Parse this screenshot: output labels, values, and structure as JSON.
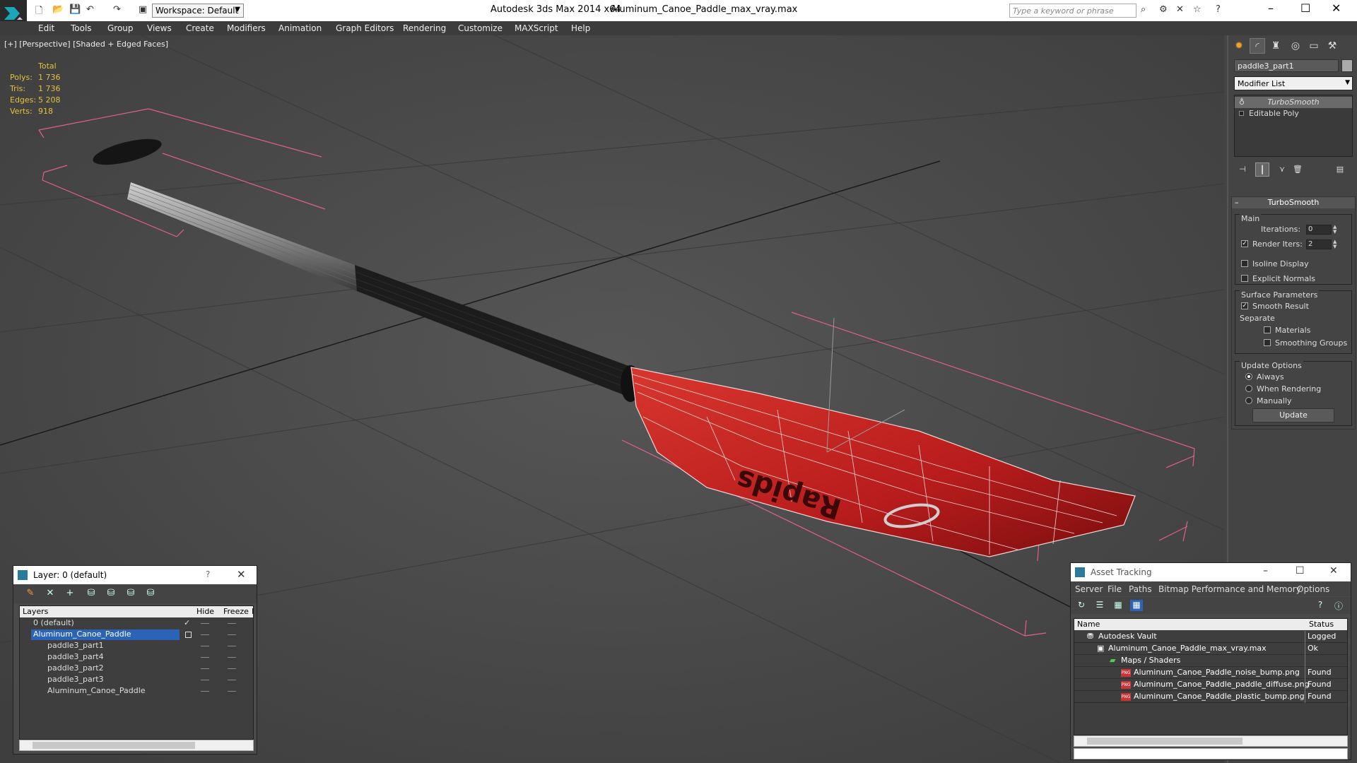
{
  "app": {
    "title": "Autodesk 3ds Max  2014 x64",
    "file": "Aluminum_Canoe_Paddle_max_vray.max",
    "workspace": "Workspace: Default",
    "search_placeholder": "Type a keyword or phrase"
  },
  "menu": [
    "Edit",
    "Tools",
    "Group",
    "Views",
    "Create",
    "Modifiers",
    "Animation",
    "Graph Editors",
    "Rendering",
    "Customize",
    "MAXScript",
    "Help"
  ],
  "viewport": {
    "label": "[+] [Perspective] [Shaded + Edged Faces]",
    "stats_header": "Total",
    "stats": [
      {
        "label": "Polys:",
        "value": "1 736"
      },
      {
        "label": "Tris:",
        "value": "1 736"
      },
      {
        "label": "Edges:",
        "value": "5 208"
      },
      {
        "label": "Verts:",
        "value": "918"
      }
    ],
    "blade_logo_text": "Rapids"
  },
  "command_panel": {
    "object_name": "paddle3_part1",
    "modifier_list": "Modifier List",
    "stack": [
      "TurboSmooth",
      "Editable Poly"
    ],
    "rollout_title": "TurboSmooth",
    "main_label": "Main",
    "iterations_label": "Iterations:",
    "iterations_value": "0",
    "render_iters_label": "Render Iters:",
    "render_iters_value": "2",
    "isoline_label": "Isoline Display",
    "explicit_normals_label": "Explicit Normals",
    "surface_params_label": "Surface Parameters",
    "smooth_result_label": "Smooth Result",
    "separate_label": "Separate",
    "materials_label": "Materials",
    "smoothing_groups_label": "Smoothing Groups",
    "update_options_label": "Update Options",
    "always_label": "Always",
    "when_rendering_label": "When Rendering",
    "manually_label": "Manually",
    "update_button": "Update"
  },
  "layer_window": {
    "title": "Layer: 0 (default)",
    "help": "?",
    "columns": [
      "Layers",
      "Hide",
      "Freeze",
      "R"
    ],
    "rows": [
      "0 (default)",
      "Aluminum_Canoe_Paddle",
      "paddle3_part1",
      "paddle3_part4",
      "paddle3_part2",
      "paddle3_part3",
      "Aluminum_Canoe_Paddle"
    ]
  },
  "asset_window": {
    "title": "Asset Tracking",
    "menu": [
      "Server",
      "File",
      "Paths",
      "Bitmap Performance and Memory",
      "Options"
    ],
    "columns": [
      "Name",
      "Status"
    ],
    "rows": [
      {
        "name": "Autodesk Vault",
        "status": "Logged"
      },
      {
        "name": "Aluminum_Canoe_Paddle_max_vray.max",
        "status": "Ok"
      },
      {
        "name": "Maps / Shaders",
        "status": ""
      },
      {
        "name": "Aluminum_Canoe_Paddle_noise_bump.png",
        "status": "Found"
      },
      {
        "name": "Aluminum_Canoe_Paddle_paddle_diffuse.png",
        "status": "Found"
      },
      {
        "name": "Aluminum_Canoe_Paddle_plastic_bump.png",
        "status": "Found"
      }
    ]
  },
  "colors": {
    "stats": "#e5c23a",
    "blade": "#b81c1c",
    "bbox": "#e0608a",
    "selection": "#2b63b8"
  }
}
